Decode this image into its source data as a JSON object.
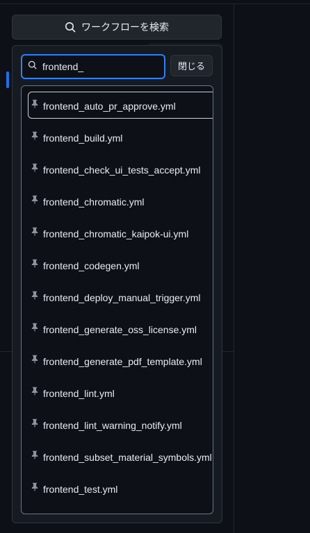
{
  "search_button": {
    "label": "ワークフローを検索",
    "icon": "search-icon"
  },
  "filter": {
    "value": "frontend_",
    "placeholder": "",
    "icon": "search-icon"
  },
  "close_button": {
    "label": "閉じる"
  },
  "results": [
    {
      "label": "frontend_auto_pr_approve.yml",
      "icon": "pin-icon",
      "focused": true
    },
    {
      "label": "frontend_build.yml",
      "icon": "pin-icon"
    },
    {
      "label": "frontend_check_ui_tests_accept.yml",
      "icon": "pin-icon"
    },
    {
      "label": "frontend_chromatic.yml",
      "icon": "pin-icon"
    },
    {
      "label": "frontend_chromatic_kaipok-ui.yml",
      "icon": "pin-icon"
    },
    {
      "label": "frontend_codegen.yml",
      "icon": "pin-icon"
    },
    {
      "label": "frontend_deploy_manual_trigger.yml",
      "icon": "pin-icon"
    },
    {
      "label": "frontend_generate_oss_license.yml",
      "icon": "pin-icon"
    },
    {
      "label": "frontend_generate_pdf_template.yml",
      "icon": "pin-icon"
    },
    {
      "label": "frontend_lint.yml",
      "icon": "pin-icon"
    },
    {
      "label": "frontend_lint_warning_notify.yml",
      "icon": "pin-icon"
    },
    {
      "label": "frontend_subset_material_symbols.yml",
      "icon": "pin-icon"
    },
    {
      "label": "frontend_test.yml",
      "icon": "pin-icon"
    }
  ],
  "colors": {
    "background": "#0d1117",
    "panel": "#161b22",
    "focus_border": "#2f81f7",
    "active_indicator": "#1f6feb",
    "text": "#e6edf3",
    "muted_icon": "#8b949e"
  }
}
